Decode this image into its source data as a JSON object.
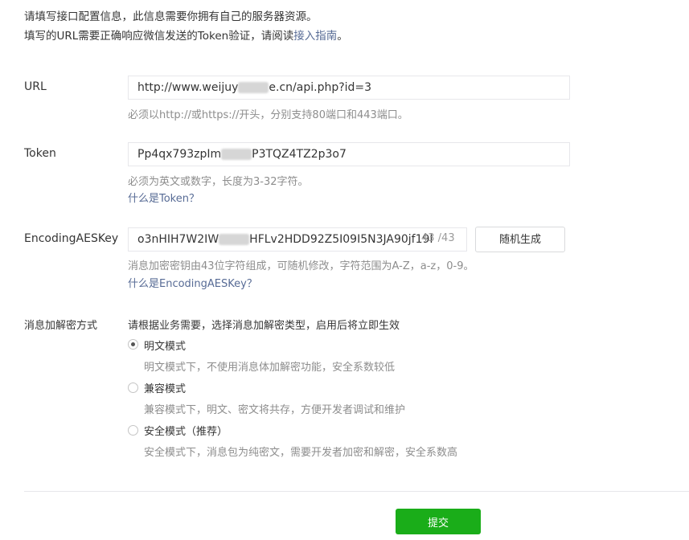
{
  "intro": {
    "line1": "请填写接口配置信息，此信息需要你拥有自己的服务器资源。",
    "line2_prefix": "填写的URL需要正确响应微信发送的Token验证，请阅读",
    "line2_link": "接入指南",
    "line2_suffix": "。"
  },
  "url": {
    "label": "URL",
    "value_prefix": "http://www.weijuy",
    "value_suffix": "e.cn/api.php?id=3",
    "hint": "必须以http://或https://开头，分别支持80端口和443端口。"
  },
  "token": {
    "label": "Token",
    "value_prefix": "Pp4qx793zpIm",
    "value_suffix": "P3TQZ4TZ2p3o7",
    "hint": "必须为英文或数字，长度为3-32字符。",
    "help": "什么是Token？"
  },
  "aes": {
    "label": "EncodingAESKey",
    "value_prefix": "o3nHIH7W2IW",
    "value_suffix": "HFLv2HDD92Z5I09I5N3JA90jf19I",
    "counter": "43 /43",
    "generate_label": "随机生成",
    "hint": "消息加密密钥由43位字符组成，可随机修改，字符范围为A-Z，a-z，0-9。",
    "help": "什么是EncodingAESKey？"
  },
  "encryption": {
    "label": "消息加解密方式",
    "title": "请根据业务需要，选择消息加解密类型，启用后将立即生效",
    "options": [
      {
        "label": "明文模式",
        "desc": "明文模式下，不使用消息体加解密功能，安全系数较低",
        "checked": true
      },
      {
        "label": "兼容模式",
        "desc": "兼容模式下，明文、密文将共存，方便开发者调试和维护",
        "checked": false
      },
      {
        "label": "安全模式（推荐）",
        "desc": "安全模式下，消息包为纯密文，需要开发者加密和解密，安全系数高",
        "checked": false
      }
    ]
  },
  "submit_label": "提交"
}
